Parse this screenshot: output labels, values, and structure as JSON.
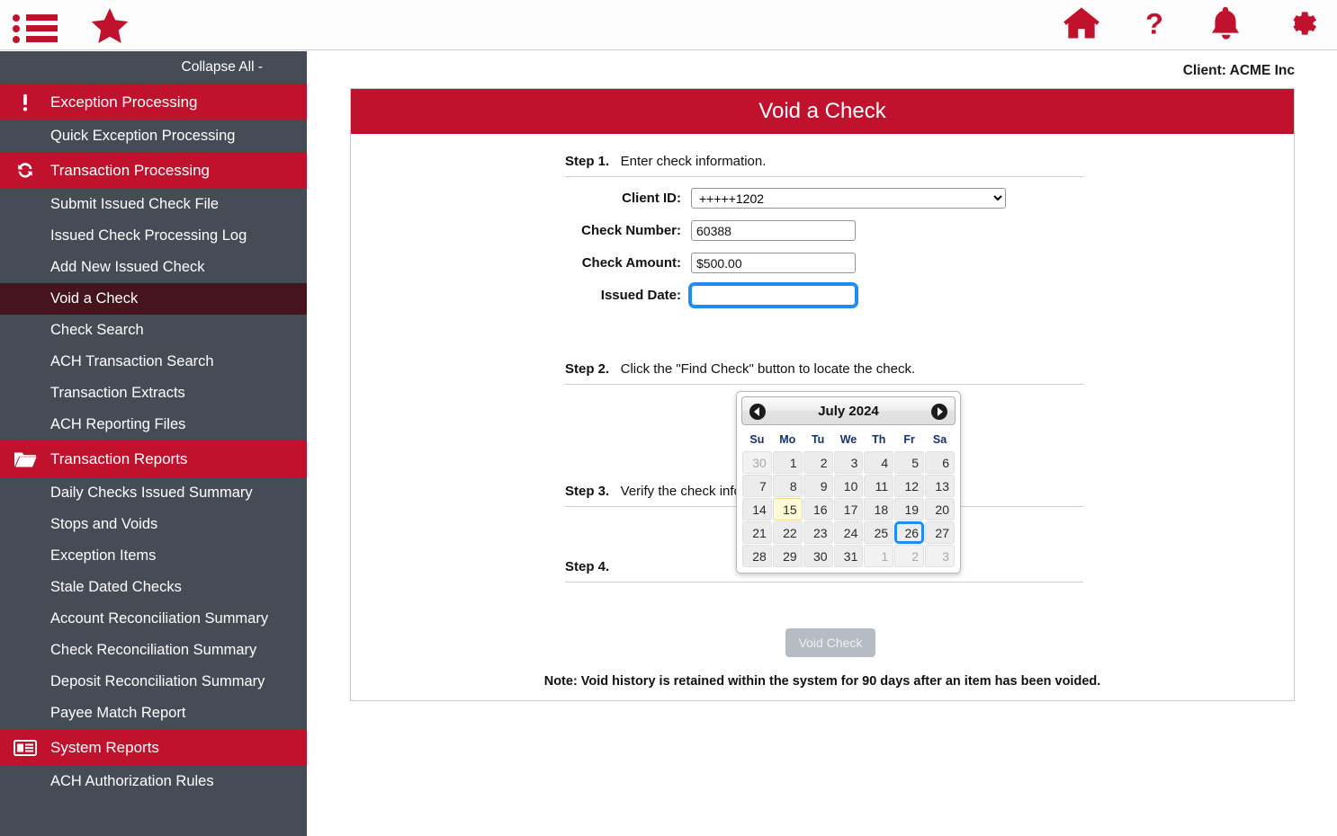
{
  "topbar": {
    "left_icons": [
      {
        "name": "menu-list-icon",
        "label": "Menu"
      },
      {
        "name": "favorites-star-icon",
        "label": "Favorites"
      }
    ],
    "right_icons": [
      {
        "name": "home-icon",
        "label": "Home"
      },
      {
        "name": "help-icon",
        "label": "Help"
      },
      {
        "name": "notifications-bell-icon",
        "label": "Notifications"
      },
      {
        "name": "settings-gear-icon",
        "label": "Settings"
      }
    ]
  },
  "sidebar": {
    "collapse_all": "Collapse All -",
    "groups": [
      {
        "label": "Exception Processing",
        "icon": "exclamation-icon",
        "items": [
          {
            "label": "Quick Exception Processing",
            "active": false
          }
        ]
      },
      {
        "label": "Transaction Processing",
        "icon": "refresh-icon",
        "items": [
          {
            "label": "Submit Issued Check File",
            "active": false
          },
          {
            "label": "Issued Check Processing Log",
            "active": false
          },
          {
            "label": "Add New Issued Check",
            "active": false
          },
          {
            "label": "Void a Check",
            "active": true
          },
          {
            "label": "Check Search",
            "active": false
          },
          {
            "label": "ACH Transaction Search",
            "active": false
          },
          {
            "label": "Transaction Extracts",
            "active": false
          },
          {
            "label": "ACH Reporting Files",
            "active": false
          }
        ]
      },
      {
        "label": "Transaction Reports",
        "icon": "folder-icon",
        "items": [
          {
            "label": "Daily Checks Issued Summary",
            "active": false
          },
          {
            "label": "Stops and Voids",
            "active": false
          },
          {
            "label": "Exception Items",
            "active": false
          },
          {
            "label": "Stale Dated Checks",
            "active": false
          },
          {
            "label": "Account Reconciliation Summary",
            "active": false
          },
          {
            "label": "Check Reconciliation Summary",
            "active": false
          },
          {
            "label": "Deposit Reconciliation Summary",
            "active": false
          },
          {
            "label": "Payee Match Report",
            "active": false
          }
        ]
      },
      {
        "label": "System Reports",
        "icon": "newspaper-icon",
        "items": [
          {
            "label": "ACH Authorization Rules",
            "active": false
          }
        ]
      }
    ]
  },
  "header": {
    "client_label": "Client:",
    "client_name": "ACME Inc",
    "client_line": "Client:  ACME Inc"
  },
  "panel": {
    "title": "Void a Check",
    "steps": [
      {
        "label": "Step 1.",
        "text": "Enter check information."
      },
      {
        "label": "Step 2.",
        "text": "Click the \"Find Check\" button to locate the check."
      },
      {
        "label": "Step 3.",
        "text": "Verify the check information."
      },
      {
        "label": "Step 4.",
        "text": ""
      }
    ],
    "fields": [
      {
        "label": "Client ID:",
        "type": "select",
        "value": "+++++1202",
        "options": [
          "+++++1202"
        ]
      },
      {
        "label": "Check Number:",
        "type": "text",
        "value": "60388",
        "placeholder": ""
      },
      {
        "label": "Check Amount:",
        "type": "text",
        "value": "$500.00",
        "placeholder": ""
      },
      {
        "label": "Issued Date:",
        "type": "text",
        "value": "",
        "placeholder": "",
        "focused": true
      }
    ],
    "void_button": "Void Check",
    "note": "Note: Void history is retained within the system for 90 days after an item has been voided."
  },
  "datepicker": {
    "title": "July 2024",
    "prev_label": "Previous Month",
    "next_label": "Next Month",
    "weekdays": [
      "Su",
      "Mo",
      "Tu",
      "We",
      "Th",
      "Fr",
      "Sa"
    ],
    "weeks": [
      [
        {
          "d": "30",
          "o": true
        },
        {
          "d": "1"
        },
        {
          "d": "2"
        },
        {
          "d": "3"
        },
        {
          "d": "4"
        },
        {
          "d": "5"
        },
        {
          "d": "6"
        }
      ],
      [
        {
          "d": "7"
        },
        {
          "d": "8"
        },
        {
          "d": "9"
        },
        {
          "d": "10"
        },
        {
          "d": "11"
        },
        {
          "d": "12"
        },
        {
          "d": "13"
        }
      ],
      [
        {
          "d": "14"
        },
        {
          "d": "15",
          "today": true
        },
        {
          "d": "16"
        },
        {
          "d": "17"
        },
        {
          "d": "18"
        },
        {
          "d": "19"
        },
        {
          "d": "20"
        }
      ],
      [
        {
          "d": "21"
        },
        {
          "d": "22"
        },
        {
          "d": "23"
        },
        {
          "d": "24"
        },
        {
          "d": "25"
        },
        {
          "d": "26",
          "focused": true
        },
        {
          "d": "27"
        }
      ],
      [
        {
          "d": "28"
        },
        {
          "d": "29"
        },
        {
          "d": "30"
        },
        {
          "d": "31"
        },
        {
          "d": "1",
          "o": true
        },
        {
          "d": "2",
          "o": true
        },
        {
          "d": "3",
          "o": true
        }
      ]
    ]
  },
  "colors": {
    "brand_red": "#c1122d",
    "sidebar_dark": "#464c55",
    "active_item": "#46141d",
    "focus_blue": "#1f8bf5",
    "today_yellow": "#fffbd6"
  }
}
